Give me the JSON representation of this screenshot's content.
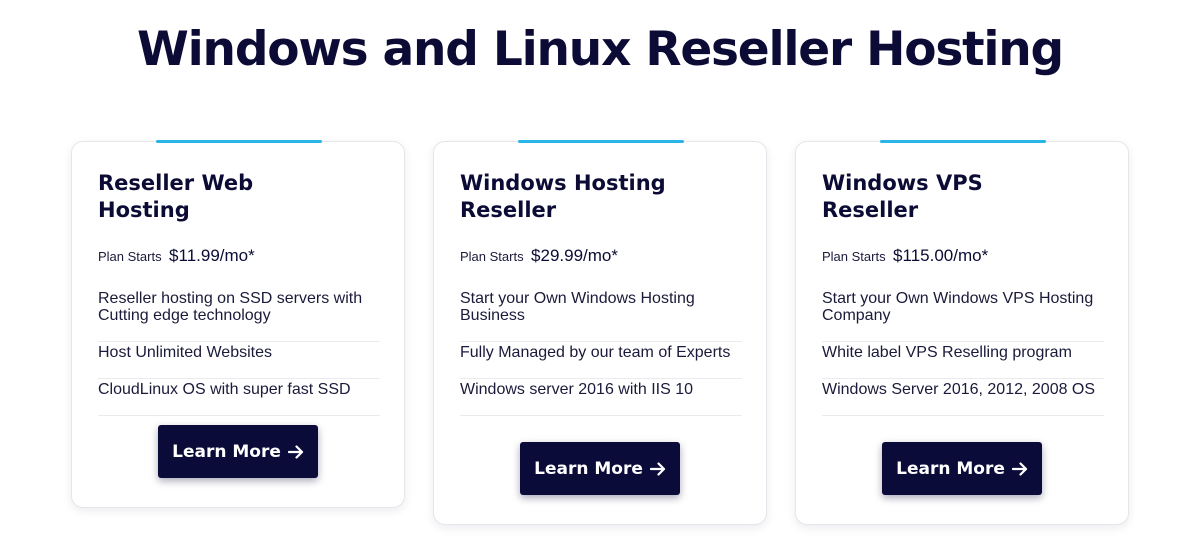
{
  "page_title": "Windows and Linux Reseller Hosting",
  "cards": [
    {
      "title": "Reseller Web Hosting",
      "price_label": "Plan Starts",
      "price": "$11.99/mo*",
      "features": [
        "Reseller hosting on SSD servers with Cutting edge technology",
        "Host Unlimited Websites",
        "CloudLinux OS with super fast SSD"
      ],
      "cta_label": "Learn More",
      "cta_icon": "arrow-right-icon"
    },
    {
      "title": "Windows Hosting Reseller",
      "price_label": "Plan Starts",
      "price": "$29.99/mo*",
      "features": [
        "Start your Own Windows Hosting Business",
        "Fully Managed by our team of Experts",
        "Windows server 2016 with IIS 10"
      ],
      "cta_label": "Learn More",
      "cta_icon": "arrow-right-icon"
    },
    {
      "title": "Windows VPS Reseller",
      "price_label": "Plan Starts",
      "price": "$115.00/mo*",
      "features": [
        "Start your Own Windows VPS Hosting Company",
        "White label VPS Reselling program",
        "Windows Server 2016, 2012, 2008 OS"
      ],
      "cta_label": "Learn More",
      "cta_icon": "arrow-right-icon"
    }
  ],
  "colors": {
    "navy": "#0b0b35",
    "accent": "#2bb5e6",
    "card_border": "#e4e6ec"
  }
}
